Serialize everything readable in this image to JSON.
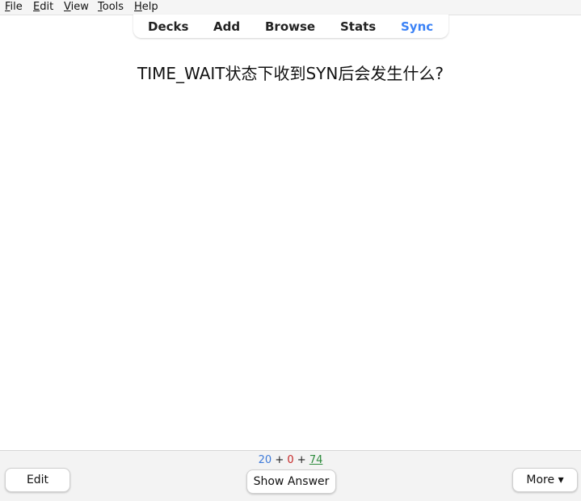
{
  "menubar": {
    "file": {
      "u": "F",
      "rest": "ile"
    },
    "edit": {
      "u": "E",
      "rest": "dit"
    },
    "view": {
      "u": "V",
      "rest": "iew"
    },
    "tools": {
      "u": "T",
      "rest": "ools"
    },
    "help": {
      "u": "H",
      "rest": "elp"
    }
  },
  "toptabs": {
    "decks": "Decks",
    "add": "Add",
    "browse": "Browse",
    "stats": "Stats",
    "sync": "Sync"
  },
  "card": {
    "question": "TIME_WAIT状态下收到SYN后会发生什么?"
  },
  "bottombar": {
    "edit_label": "Edit",
    "show_answer_label": "Show Answer",
    "more_label": "More ▾",
    "counts": {
      "new": "20",
      "sep1": " + ",
      "learn": "0",
      "sep2": " + ",
      "review": "74"
    }
  },
  "colors": {
    "new": "#3d7ad9",
    "learn": "#c62828",
    "review": "#2e8b3d",
    "sync": "#3b82f6"
  }
}
